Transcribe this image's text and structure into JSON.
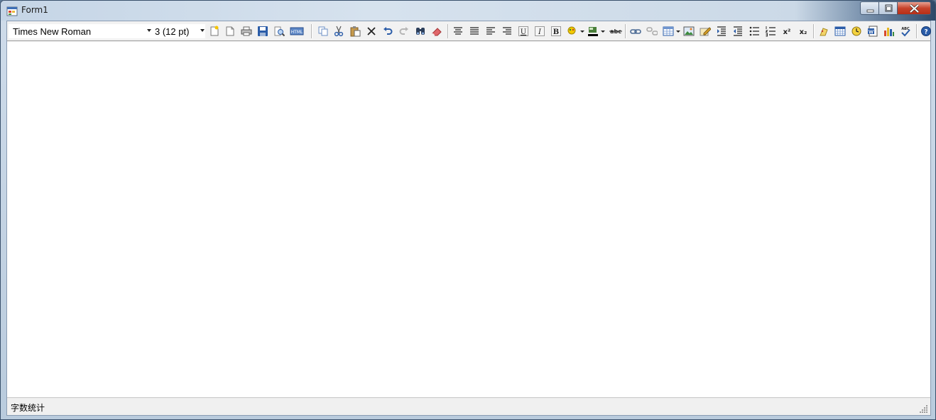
{
  "window": {
    "title": "Form1"
  },
  "toolbar": {
    "font_name": "Times New Roman",
    "font_size": "3 (12 pt)",
    "buttons": [
      {
        "name": "new-icon"
      },
      {
        "name": "open-icon"
      },
      {
        "name": "print-icon"
      },
      {
        "name": "save-icon"
      },
      {
        "name": "preview-icon"
      },
      {
        "name": "html-icon"
      },
      {
        "name": "copy-icon"
      },
      {
        "name": "cut-icon"
      },
      {
        "name": "paste-icon"
      },
      {
        "name": "delete-icon"
      },
      {
        "name": "undo-icon"
      },
      {
        "name": "redo-icon"
      },
      {
        "name": "find-icon"
      },
      {
        "name": "eraser-icon"
      },
      {
        "name": "align-center-icon"
      },
      {
        "name": "justify-icon"
      },
      {
        "name": "align-left-icon"
      },
      {
        "name": "align-right-icon"
      },
      {
        "name": "underline-icon"
      },
      {
        "name": "italic-icon"
      },
      {
        "name": "bold-icon"
      },
      {
        "name": "highlight-icon"
      },
      {
        "name": "font-color-icon"
      },
      {
        "name": "strikethrough-icon"
      },
      {
        "name": "link-icon"
      },
      {
        "name": "unlink-icon"
      },
      {
        "name": "table-icon"
      },
      {
        "name": "image-icon"
      },
      {
        "name": "edit-icon"
      },
      {
        "name": "indent-icon"
      },
      {
        "name": "outdent-icon"
      },
      {
        "name": "bullet-list-icon"
      },
      {
        "name": "numbered-list-icon"
      },
      {
        "name": "superscript-icon"
      },
      {
        "name": "subscript-icon"
      },
      {
        "name": "special-char-icon"
      },
      {
        "name": "calendar-icon"
      },
      {
        "name": "clock-icon"
      },
      {
        "name": "word-icon"
      },
      {
        "name": "chart-icon"
      },
      {
        "name": "spellcheck-icon"
      },
      {
        "name": "help-icon"
      }
    ],
    "labels": {
      "underline": "U",
      "italic": "I",
      "bold": "B",
      "strike": "abc",
      "superscript": "x²",
      "subscript": "x₂",
      "spell": "ABC",
      "html": "HTML"
    }
  },
  "status": {
    "text": "字数统计"
  },
  "colors": {
    "accent_blue": "#2a5ca8",
    "close_red": "#c7432b",
    "editor_bg": "#ffffff"
  }
}
